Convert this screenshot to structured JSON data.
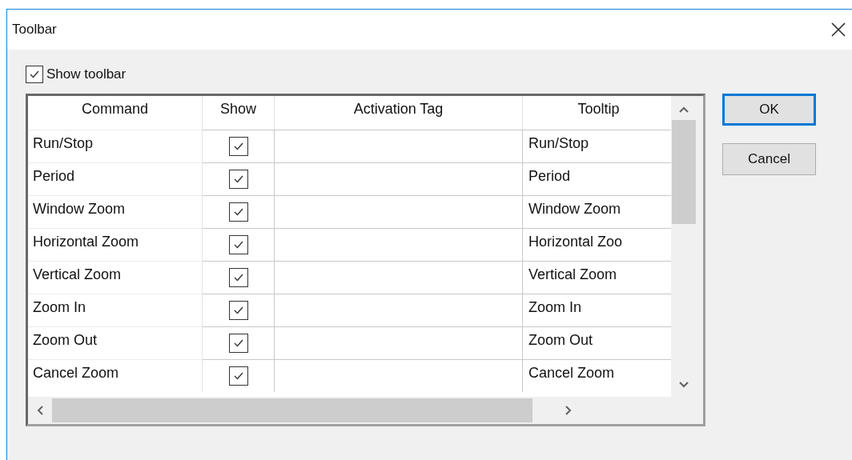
{
  "window": {
    "title": "Toolbar"
  },
  "show_toolbar": {
    "label": "Show toolbar",
    "checked": true
  },
  "table": {
    "columns": [
      "Command",
      "Show",
      "Activation Tag",
      "Tooltip"
    ],
    "rows": [
      {
        "command": "Run/Stop",
        "show": true,
        "tooltip": "Run/Stop"
      },
      {
        "command": "Period",
        "show": true,
        "tooltip": "Period"
      },
      {
        "command": "Window Zoom",
        "show": true,
        "tooltip": "Window Zoom"
      },
      {
        "command": "Horizontal Zoom",
        "show": true,
        "tooltip": "Horizontal Zoo"
      },
      {
        "command": "Vertical Zoom",
        "show": true,
        "tooltip": "Vertical Zoom"
      },
      {
        "command": "Zoom In",
        "show": true,
        "tooltip": "Zoom In"
      },
      {
        "command": "Zoom Out",
        "show": true,
        "tooltip": "Zoom Out"
      },
      {
        "command": "Cancel Zoom",
        "show": true,
        "tooltip": "Cancel Zoom"
      }
    ]
  },
  "buttons": [
    {
      "label": "OK",
      "default": true
    },
    {
      "label": "Cancel",
      "default": false
    }
  ]
}
